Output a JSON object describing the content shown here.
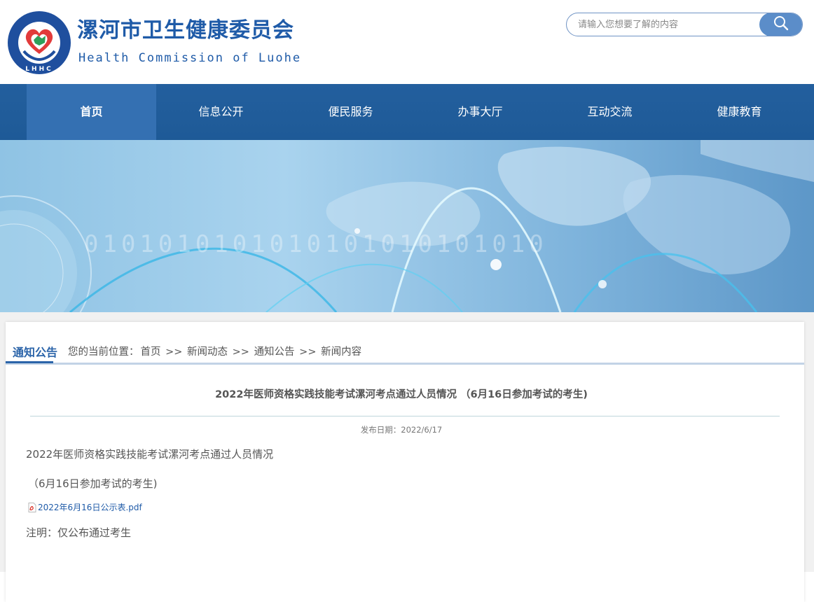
{
  "header": {
    "logo_letters": "LHHC",
    "logo_ring_text": "漯河市卫生健康委员会",
    "title": "漯河市卫生健康委员会",
    "subtitle": "Health Commission of Luohe",
    "search_placeholder": "请输入您想要了解的内容"
  },
  "nav": {
    "items": [
      {
        "label": "首页"
      },
      {
        "label": "信息公开"
      },
      {
        "label": "便民服务"
      },
      {
        "label": "办事大厅"
      },
      {
        "label": "互动交流"
      },
      {
        "label": "健康教育"
      }
    ],
    "active_index": 0
  },
  "banner": {
    "binary_text": "0101010101010101010101010"
  },
  "section": {
    "label": "通知公告",
    "breadcrumb_prefix": "您的当前位置：",
    "breadcrumb": [
      "首页",
      "新闻动态",
      "通知公告",
      "新闻内容"
    ],
    "separator": ">>"
  },
  "article": {
    "title": "2022年医师资格实践技能考试漯河考点通过人员情况 （6月16日参加考试的考生)",
    "date_label": "发布日期：",
    "date": "2022/6/17",
    "paragraph1": "2022年医师资格实践技能考试漯河考点通过人员情况",
    "paragraph2": "（6月16日参加考试的考生)",
    "attachment": "2022年6月16日公示表.pdf",
    "note": "注明：仅公布通过考生"
  },
  "colors": {
    "brand_blue": "#1f5ba8",
    "nav_bg": "#1e5a97",
    "nav_active": "#3470b2"
  }
}
